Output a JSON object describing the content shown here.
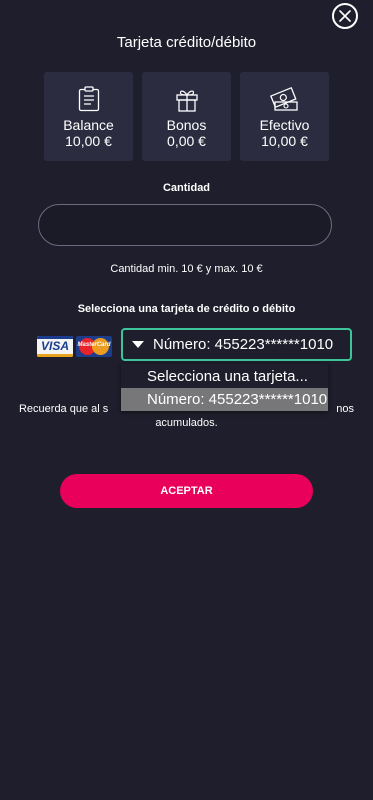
{
  "header": {
    "title": "Tarjeta crédito/débito",
    "close_icon": "close-icon"
  },
  "cards": [
    {
      "label": "Balance",
      "value": "10,00 €",
      "icon": "clipboard-icon"
    },
    {
      "label": "Bonos",
      "value": "0,00 €",
      "icon": "gift-icon"
    },
    {
      "label": "Efectivo",
      "value": "10,00 €",
      "icon": "cash-icon"
    }
  ],
  "amount": {
    "label": "Cantidad",
    "value": "",
    "limits": "Cantidad min. 10 € y max. 10 €"
  },
  "card_select": {
    "label": "Selecciona una tarjeta de crédito o débito",
    "selected": "Número: 455223******1010",
    "options": [
      "Selecciona una tarjeta...",
      "Número: 455223******1010"
    ],
    "logos": {
      "visa": "VISA",
      "mastercard": "MasterCard"
    }
  },
  "note": {
    "line1_start": "Recuerda que al s",
    "line1_end": "nos",
    "line2": "acumulados."
  },
  "accept_button": "ACEPTAR",
  "colors": {
    "background": "#1e1e2c",
    "card": "#2c2c41",
    "accent": "#e8005a",
    "select_border": "#3ec49b"
  }
}
